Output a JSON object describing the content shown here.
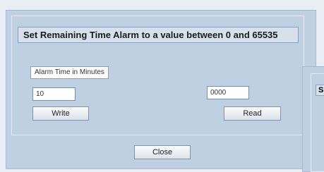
{
  "dialog": {
    "banner": "Set Remaining Time Alarm to a value between 0 and  65535",
    "alarm_label": "Alarm Time in Minutes",
    "write_value": "10",
    "read_value": "0000",
    "write_button": "Write",
    "read_button": "Read",
    "close_button": "Close"
  },
  "side_panel": {
    "partial_text": "S"
  }
}
